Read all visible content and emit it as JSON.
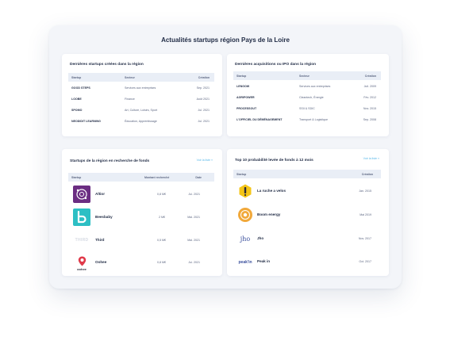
{
  "page_title": "Actualités startups région Pays de la Loire",
  "recent": {
    "title": "Dernières startups créées dans la région",
    "headers": [
      "Startup",
      "Secteur",
      "Création"
    ],
    "rows": [
      {
        "name": "GOOD STEPS",
        "sector": "Services aux entreprises",
        "date": "Sep. 2021"
      },
      {
        "name": "LOOBE",
        "sector": "Finance",
        "date": "Août 2021"
      },
      {
        "name": "SPOMO",
        "sector": "Art, Culture, Loisirs, Sport",
        "date": "Jul. 2021"
      },
      {
        "name": "NEODIDIT LEARNING",
        "sector": "Éducation, Apprentissage",
        "date": "Jul. 2021"
      }
    ]
  },
  "acquisitions": {
    "title": "Dernières acquisitions ou IPO dans la région",
    "headers": [
      "Startup",
      "Secteur",
      "Création"
    ],
    "rows": [
      {
        "name": "LENGOW",
        "sector": "Services aux entreprises",
        "date": "Juil. 2009"
      },
      {
        "name": "AGRIPOWER",
        "sector": "Cleantech, Énergie",
        "date": "Fév. 2012"
      },
      {
        "name": "PROCESSOUT",
        "sector": "SSII & SDIC",
        "date": "Nov. 2015"
      },
      {
        "name": "L'OFFICIEL DU DÉMÉNAGEMENT",
        "sector": "Transport & Logistique",
        "date": "Sep. 2008"
      }
    ]
  },
  "funding": {
    "title": "Startups de la région en recherche de fonds",
    "see_all": "Voir la liste »",
    "headers": [
      "Startup",
      "Montant recherché",
      "Date"
    ],
    "rows": [
      {
        "name": "Altior",
        "amount": "0,8 M€",
        "date": "Jui. 2021",
        "logo": "altior-logo"
      },
      {
        "name": "Beesbaby",
        "amount": "2 M€",
        "date": "Mai. 2021",
        "logo": "beesbaby-logo"
      },
      {
        "name": "Third",
        "amount": "0,5 M€",
        "date": "Mai. 2021",
        "logo": "third-logo",
        "logo_text": "THIRD"
      },
      {
        "name": "Oohee",
        "amount": "0,8 M€",
        "date": "Jui. 2021",
        "logo": "oohee-logo",
        "logo_text": "oohee"
      }
    ]
  },
  "top10": {
    "title": "Top 10 probabilité levée de fonds à 12 mois",
    "see_all": "Voir la liste »",
    "headers": [
      "Startup",
      "Création"
    ],
    "rows": [
      {
        "name": "La ruche a velos",
        "date": "Jan. 2015",
        "logo": "ruche-logo"
      },
      {
        "name": "Boom energy",
        "date": "Mai 2019",
        "logo": "boom-logo"
      },
      {
        "name": "Jho",
        "date": "Nov. 2017",
        "logo": "jho-logo",
        "logo_text": "jho"
      },
      {
        "name": "Peak in",
        "date": "Oct. 2017",
        "logo": "peakin-logo",
        "logo_text": "peak'in"
      }
    ]
  },
  "colors": {
    "accent": "#57b7e9",
    "altior": "#6b2d82",
    "beesbaby": "#2dbfc4",
    "oohee": "#e03a4a",
    "ruche": "#f4c518",
    "boom": "#f1a83a",
    "peakin": "#3a4f9c"
  }
}
